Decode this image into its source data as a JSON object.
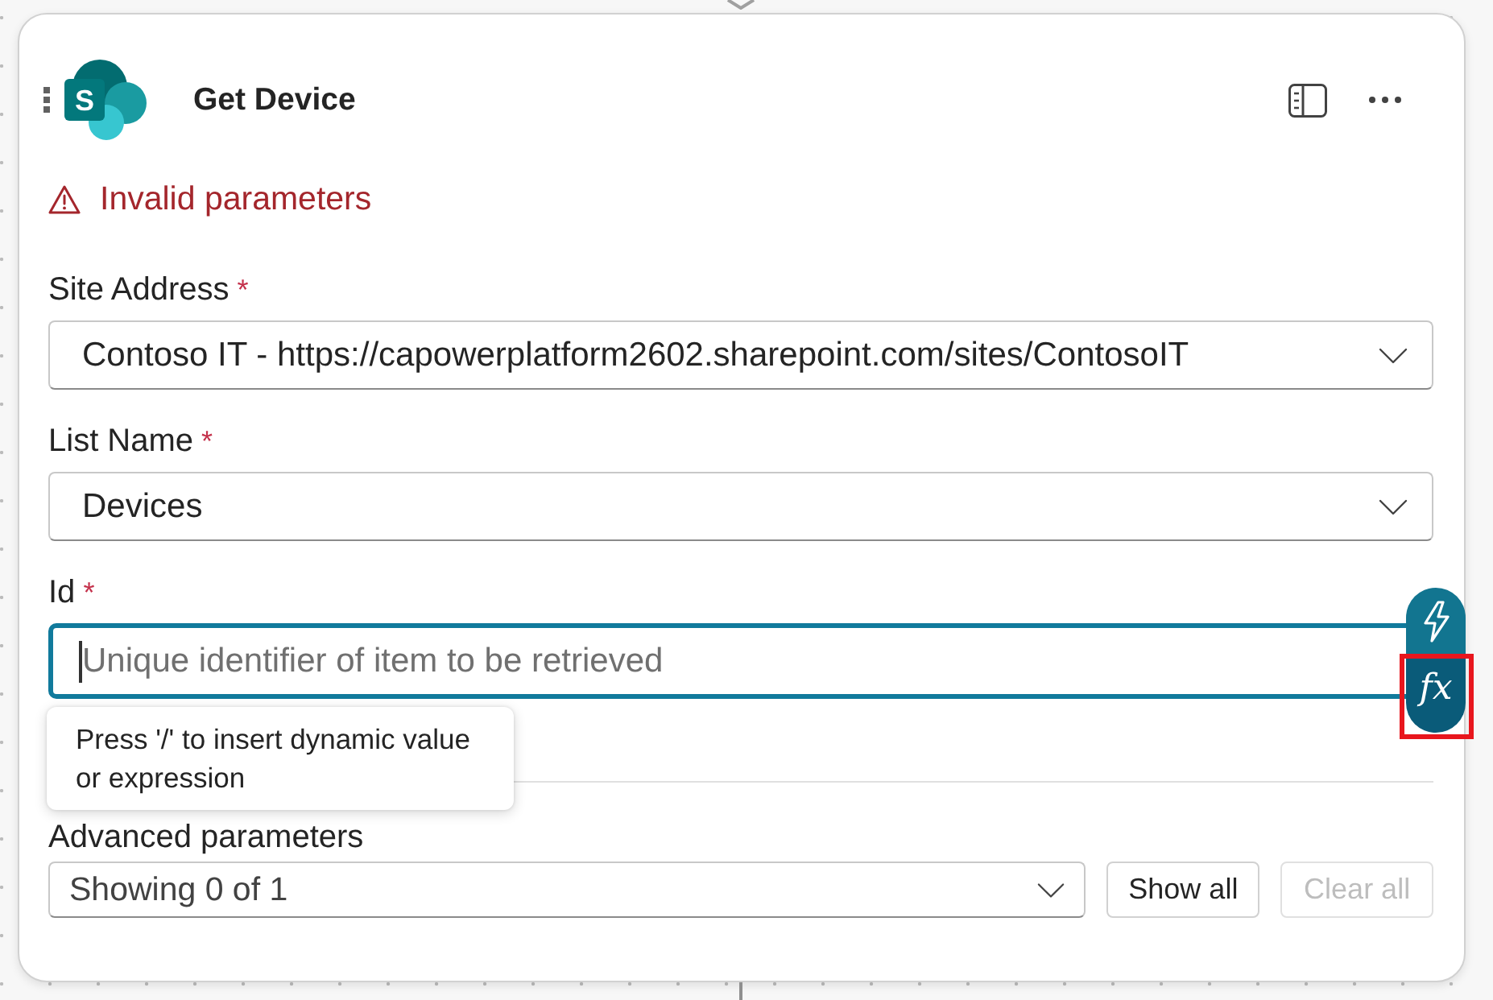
{
  "card": {
    "logo_text": "S",
    "title": "Get Device",
    "error": "Invalid parameters"
  },
  "fields": [
    {
      "kind": "dropdown",
      "label": "Site Address",
      "required_mark": "*",
      "value": "Contoso IT - https://capowerplatform2602.sharepoint.com/sites/ContosoIT"
    },
    {
      "kind": "dropdown",
      "label": "List Name",
      "required_mark": "*",
      "value": "Devices"
    },
    {
      "kind": "text",
      "label": "Id",
      "required_mark": "*",
      "placeholder": "Unique identifier of item to be retrieved",
      "focused": true,
      "side_buttons": [
        {
          "kind": "dynamic",
          "selected": false,
          "highlighted": false
        },
        {
          "kind": "expression",
          "label": "fx",
          "selected": true,
          "highlighted": true
        }
      ],
      "tooltip": "Press '/' to insert dynamic value or expression"
    }
  ],
  "advanced": {
    "label": "Advanced parameters",
    "value": "Showing 0 of 1",
    "buttons": [
      {
        "label": "Show all",
        "disabled": false
      },
      {
        "label": "Clear all",
        "disabled": true
      }
    ]
  }
}
